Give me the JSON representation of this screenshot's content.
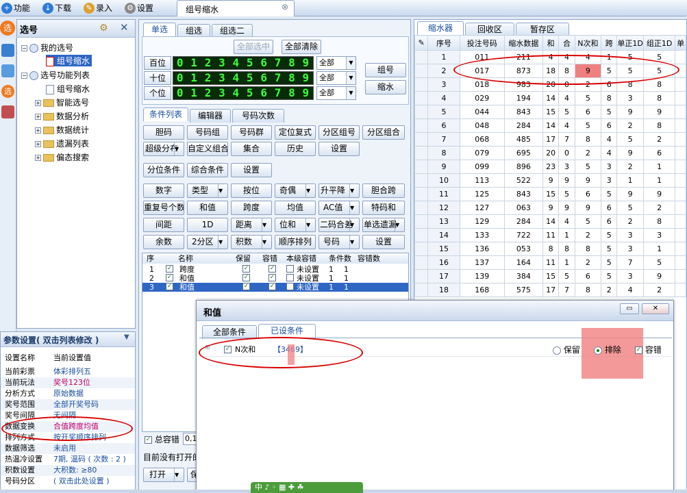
{
  "menu": {
    "items": [
      {
        "label": "功能",
        "icon": "plus-icon",
        "color": "#2e7cd6"
      },
      {
        "label": "下载",
        "icon": "download-icon",
        "color": "#2e7cd6"
      },
      {
        "label": "录入",
        "icon": "pencil-icon",
        "color": "#d9a232"
      },
      {
        "label": "设置",
        "icon": "gear-icon",
        "color": "#8a8a8a"
      }
    ]
  },
  "doc_tab": {
    "title": "组号缩水",
    "close": "⊗"
  },
  "left_panel": {
    "title": "选号",
    "tree": [
      {
        "label": "我的选号",
        "level": 0,
        "expander": "−"
      },
      {
        "label": "组号缩水",
        "level": 1,
        "selected": true
      },
      {
        "label": "选号功能列表",
        "level": 0,
        "expander": "−"
      },
      {
        "label": "组号缩水",
        "level": 1
      },
      {
        "label": "智能选号",
        "level": 1,
        "expander": "+"
      },
      {
        "label": "数据分析",
        "level": 1,
        "expander": "+"
      },
      {
        "label": "数据统计",
        "level": 1,
        "expander": "+"
      },
      {
        "label": "遗漏列表",
        "level": 1,
        "expander": "+"
      },
      {
        "label": "偏态搜索",
        "level": 1,
        "expander": "+"
      }
    ]
  },
  "params": {
    "title": "参数设置( 双击列表修改 )",
    "header": {
      "name": "设置名称",
      "value": "当前设置值"
    },
    "rows": [
      {
        "name": "当前彩票",
        "value": "体彩排列五"
      },
      {
        "name": "当前玩法",
        "value": "奖号123位",
        "highlight": "#c0006a"
      },
      {
        "name": "分析方式",
        "value": "原始数据"
      },
      {
        "name": "奖号范围",
        "value": "全部开奖号码"
      },
      {
        "name": "奖号间隔",
        "value": "无间隔"
      },
      {
        "name": "数据变换",
        "value": "合值跨度均值",
        "highlight": "#c0006a"
      },
      {
        "name": "排列方式",
        "value": "按开奖顺序排列"
      },
      {
        "name": "数据筛选",
        "value": "未启用"
      },
      {
        "name": "热温冷设置",
        "value": "7期, 温码 ( 次数 : 2 )"
      },
      {
        "name": "积数设置",
        "value": "大积数: ≥80"
      },
      {
        "name": "号码分区",
        "value": "( 双击此处设置 )"
      }
    ]
  },
  "middle": {
    "top_tabs": [
      "单选",
      "组选",
      "组选二"
    ],
    "select_all": "全部选中",
    "clear_all": "全部清除",
    "positions": [
      {
        "label": "百位",
        "digits": [
          "0",
          "1",
          "2",
          "3",
          "4",
          "5",
          "6",
          "7",
          "8",
          "9"
        ],
        "option": "全部"
      },
      {
        "label": "十位",
        "digits": [
          "0",
          "1",
          "2",
          "3",
          "4",
          "5",
          "6",
          "7",
          "8",
          "9"
        ],
        "option": "全部"
      },
      {
        "label": "个位",
        "digits": [
          "0",
          "1",
          "2",
          "3",
          "4",
          "5",
          "6",
          "7",
          "8",
          "9"
        ],
        "option": "全部"
      }
    ],
    "group_button": "组号",
    "shrink_button": "缩水",
    "cond_tabs": [
      "条件列表",
      "编辑器",
      "号码次数"
    ],
    "buttons_row1": [
      "胆码",
      "号码组",
      "号码群",
      "定位复式",
      "分区组号",
      "分区组合"
    ],
    "buttons_row2": [
      "超级分布",
      "自定义组合",
      "集合",
      "历史",
      "设置"
    ],
    "buttons_row3": [
      "分位条件",
      "综合条件",
      "设置"
    ],
    "buttons_row4": [
      "数字",
      "类型",
      "按位",
      "奇偶",
      "升平降",
      "胆合跨"
    ],
    "buttons_row5": [
      "重复号个数",
      "和值",
      "跨度",
      "均值",
      "AC值",
      "特码和"
    ],
    "buttons_row6": [
      "间距",
      "1D",
      "距离",
      "位和",
      "二码合差",
      "单选遗漏"
    ],
    "buttons_row7": [
      "余数",
      "2分区",
      "积数",
      "顺序排列",
      "号码",
      "设置"
    ],
    "list_headers": [
      "序",
      "",
      "名称",
      "保留",
      "容错",
      "本级容错",
      "条件数",
      "容错数"
    ],
    "list_rows": [
      {
        "idx": "1",
        "name": "跨度",
        "level": "未设置",
        "count": "1",
        "err": "1"
      },
      {
        "idx": "2",
        "name": "和值",
        "level": "未设置",
        "count": "1",
        "err": "1"
      },
      {
        "idx": "3",
        "name": "和值",
        "level": "未设置",
        "count": "1",
        "err": "1"
      }
    ],
    "total_err_label": "总容错",
    "total_err_value": "0,1",
    "status": "目前没有打开的",
    "open_button": "打开",
    "save_button": "保"
  },
  "right": {
    "tabs": [
      "缩水器",
      "回收区",
      "暂存区"
    ],
    "headers": [
      "序号",
      "投注号码",
      "缩水数据",
      "和",
      "合",
      "N次和",
      "跨",
      "单正1D",
      "组正1D",
      "单"
    ],
    "rows": [
      [
        "1",
        "011",
        "211",
        "4",
        "4",
        "4",
        "1",
        "5",
        "5"
      ],
      [
        "2",
        "017",
        "873",
        "18",
        "8",
        "9",
        "5",
        "5",
        "5"
      ],
      [
        "3",
        "018",
        "983",
        "20",
        "0",
        "2",
        "6",
        "8",
        "8"
      ],
      [
        "4",
        "029",
        "194",
        "14",
        "4",
        "5",
        "8",
        "3",
        "8"
      ],
      [
        "5",
        "044",
        "843",
        "15",
        "5",
        "6",
        "5",
        "9",
        "9"
      ],
      [
        "6",
        "048",
        "284",
        "14",
        "4",
        "5",
        "6",
        "2",
        "8"
      ],
      [
        "7",
        "068",
        "485",
        "17",
        "7",
        "8",
        "4",
        "5",
        "2"
      ],
      [
        "8",
        "079",
        "695",
        "20",
        "0",
        "2",
        "4",
        "9",
        "6"
      ],
      [
        "9",
        "099",
        "896",
        "23",
        "3",
        "5",
        "3",
        "2",
        "1"
      ],
      [
        "10",
        "113",
        "522",
        "9",
        "9",
        "9",
        "3",
        "1",
        "1"
      ],
      [
        "11",
        "125",
        "843",
        "15",
        "5",
        "6",
        "5",
        "9",
        "9"
      ],
      [
        "12",
        "127",
        "063",
        "9",
        "9",
        "9",
        "6",
        "5",
        "2"
      ],
      [
        "13",
        "129",
        "284",
        "14",
        "4",
        "5",
        "6",
        "2",
        "8"
      ],
      [
        "14",
        "133",
        "722",
        "11",
        "1",
        "2",
        "5",
        "3",
        "3"
      ],
      [
        "15",
        "136",
        "053",
        "8",
        "8",
        "8",
        "5",
        "3",
        "1"
      ],
      [
        "16",
        "137",
        "164",
        "11",
        "1",
        "2",
        "5",
        "7",
        "5"
      ],
      [
        "17",
        "139",
        "384",
        "15",
        "5",
        "6",
        "5",
        "3",
        "9"
      ],
      [
        "18",
        "168",
        "575",
        "17",
        "7",
        "8",
        "2",
        "4",
        "2"
      ]
    ]
  },
  "dialog": {
    "title": "和值",
    "tabs": [
      "全部条件",
      "已设条件"
    ],
    "condition_label": "N次和",
    "condition_value": "【3469】",
    "keep_label": "保留",
    "exclude_label": "排除",
    "tolerance_label": "容错"
  },
  "ime": {
    "label": "中 ♪ ◦ ▦ ✚ ☘"
  },
  "colors": {
    "accent": "#1a4fa0",
    "highlight_red": "#d80000",
    "led_green": "#3cff3c"
  }
}
